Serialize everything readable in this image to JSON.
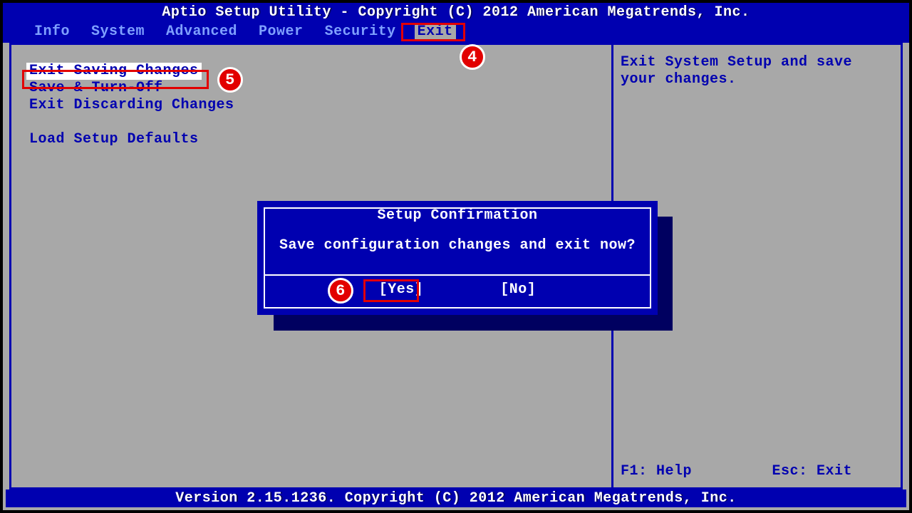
{
  "header": {
    "title": "Aptio Setup Utility - Copyright (C) 2012 American Megatrends, Inc."
  },
  "menubar": {
    "tabs": [
      {
        "label": "Info"
      },
      {
        "label": "System"
      },
      {
        "label": "Advanced"
      },
      {
        "label": "Power"
      },
      {
        "label": "Security"
      },
      {
        "label": "Exit"
      }
    ],
    "active_index": 5
  },
  "left_pane": {
    "items": [
      "Exit Saving Changes",
      "Save & Turn-Off",
      "Exit Discarding Changes",
      "",
      "Load Setup Defaults"
    ],
    "selected_index": 0
  },
  "right_pane": {
    "description": "Exit System Setup and save your changes.",
    "hints": {
      "f1": "F1: Help",
      "esc": "Esc: Exit"
    }
  },
  "dialog": {
    "title": "Setup Confirmation",
    "message": "Save configuration changes and exit now?",
    "buttons": {
      "yes": "[Yes]",
      "no": "[No]"
    }
  },
  "footer": {
    "text": "Version 2.15.1236. Copyright (C) 2012 American Megatrends, Inc."
  },
  "annotations": {
    "b4": "4",
    "b5": "5",
    "b6": "6"
  },
  "colors": {
    "bios_blue": "#0000b0",
    "panel_gray": "#a8a8a8",
    "callout_red": "#e20000"
  }
}
